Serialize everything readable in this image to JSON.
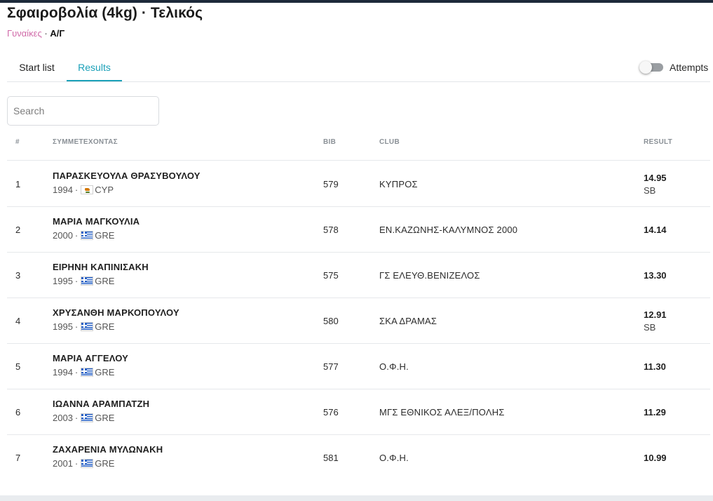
{
  "event": {
    "title": "Σφαιροβολία (4kg) · Τελικός",
    "category": "Γυναίκες",
    "separator": "·",
    "age_group": "Α/Γ"
  },
  "tabs": [
    {
      "label": "Start list",
      "active": false
    },
    {
      "label": "Results",
      "active": true
    }
  ],
  "attempts_toggle": {
    "label": "Attempts",
    "on": false
  },
  "search": {
    "placeholder": "Search",
    "value": ""
  },
  "table": {
    "headers": {
      "rank": "#",
      "athlete": "ΣΥΜΜΕΤΕΧΟΝΤΑΣ",
      "bib": "BIB",
      "club": "CLUB",
      "result": "RESULT"
    },
    "rows": [
      {
        "rank": "1",
        "name": "ΠΑΡΑΣΚΕΥΟΥΛΑ ΘΡΑΣΥΒΟΥΛΟΥ",
        "year": "1994",
        "dot": "·",
        "flag_icon": "cyprus-flag-icon",
        "country": "CYP",
        "bib": "579",
        "club": "ΚΥΠΡΟΣ",
        "result": "14.95",
        "note": "SB"
      },
      {
        "rank": "2",
        "name": "ΜΑΡΙΑ ΜΑΓΚΟΥΛΙΑ",
        "year": "2000",
        "dot": "·",
        "flag_icon": "greece-flag-icon",
        "country": "GRE",
        "bib": "578",
        "club": "ΕΝ.ΚΑΖΩΝΗΣ-ΚΑΛΥΜΝΟΣ 2000",
        "result": "14.14",
        "note": ""
      },
      {
        "rank": "3",
        "name": "ΕΙΡΗΝΗ ΚΑΠΙΝΙΣΑΚΗ",
        "year": "1995",
        "dot": "·",
        "flag_icon": "greece-flag-icon",
        "country": "GRE",
        "bib": "575",
        "club": "ΓΣ ΕΛΕΥΘ.ΒΕΝΙΖΕΛΟΣ",
        "result": "13.30",
        "note": ""
      },
      {
        "rank": "4",
        "name": "ΧΡΥΣΑΝΘΗ ΜΑΡΚΟΠΟΥΛΟΥ",
        "year": "1995",
        "dot": "·",
        "flag_icon": "greece-flag-icon",
        "country": "GRE",
        "bib": "580",
        "club": "ΣΚΑ ΔΡΑΜΑΣ",
        "result": "12.91",
        "note": "SB"
      },
      {
        "rank": "5",
        "name": "ΜΑΡΙΑ ΑΓΓΕΛΟΥ",
        "year": "1994",
        "dot": "·",
        "flag_icon": "greece-flag-icon",
        "country": "GRE",
        "bib": "577",
        "club": "Ο.Φ.Η.",
        "result": "11.30",
        "note": ""
      },
      {
        "rank": "6",
        "name": "ΙΩΑΝΝΑ ΑΡΑΜΠΑΤΖΗ",
        "year": "2003",
        "dot": "·",
        "flag_icon": "greece-flag-icon",
        "country": "GRE",
        "bib": "576",
        "club": "ΜΓΣ ΕΘΝΙΚΟΣ ΑΛΕΞ/ΠΟΛΗΣ",
        "result": "11.29",
        "note": ""
      },
      {
        "rank": "7",
        "name": "ΖΑΧΑΡΕΝΙΑ ΜΥΛΩΝΑΚΗ",
        "year": "2001",
        "dot": "·",
        "flag_icon": "greece-flag-icon",
        "country": "GRE",
        "bib": "581",
        "club": "Ο.Φ.Η.",
        "result": "10.99",
        "note": ""
      }
    ]
  },
  "colors": {
    "accent": "#1aa0b8",
    "category": "#d06aa8",
    "header_bar": "#1d2a3a"
  }
}
